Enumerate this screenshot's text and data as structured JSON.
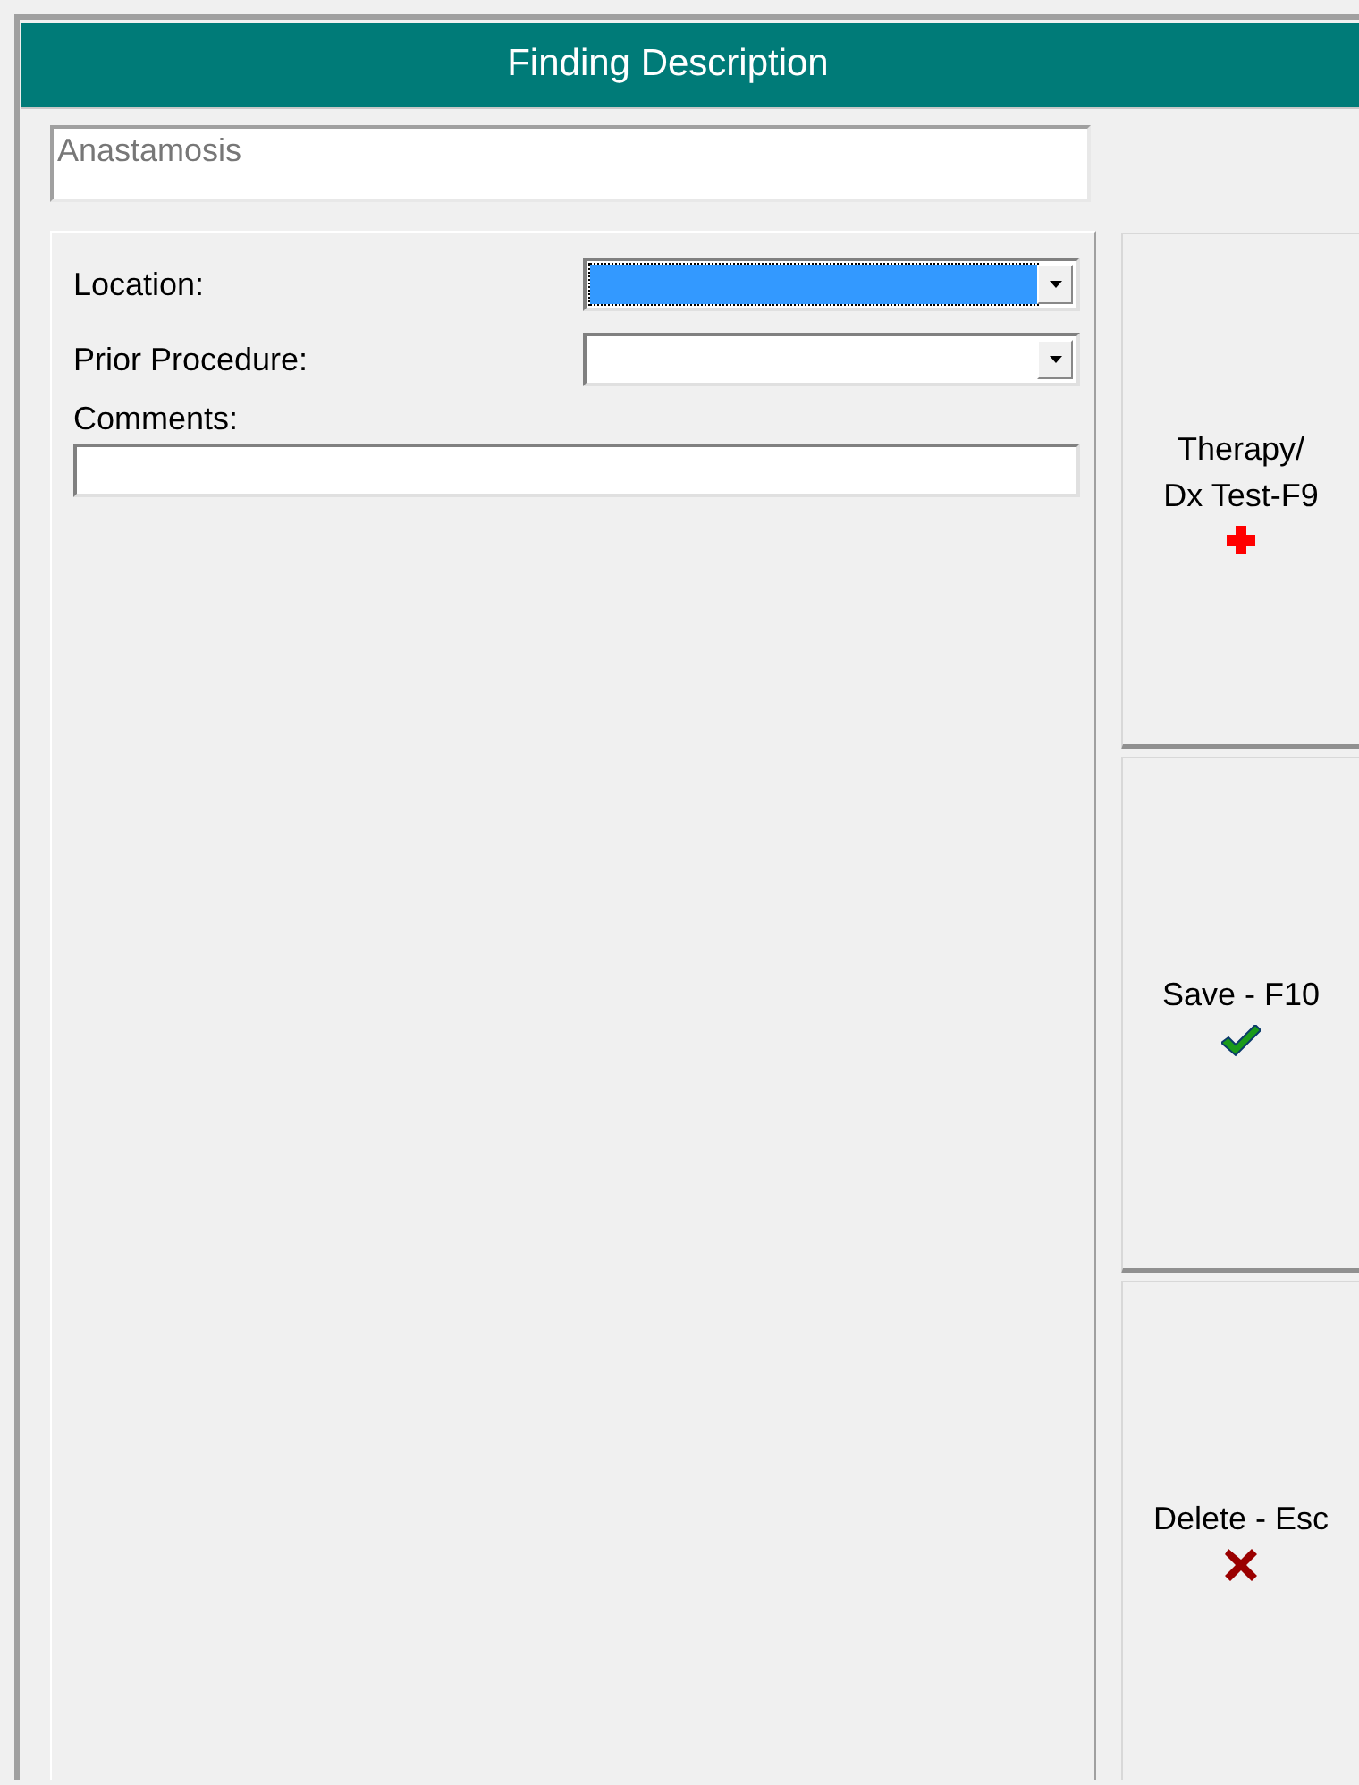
{
  "window": {
    "title": "Finding Description"
  },
  "finding": {
    "value": "Anastamosis"
  },
  "fields": [
    {
      "kind": "combo",
      "label": "Location:",
      "selected": true
    },
    {
      "kind": "combo",
      "label": "Prior Procedure:",
      "selected": false
    },
    {
      "kind": "text",
      "label": "Comments:"
    }
  ],
  "buttons": [
    {
      "label": "Therapy/\nDx Test-F9",
      "kind": "plus"
    },
    {
      "label": "Save - F10",
      "kind": "check"
    },
    {
      "label": "Delete - Esc",
      "kind": "cross"
    }
  ]
}
